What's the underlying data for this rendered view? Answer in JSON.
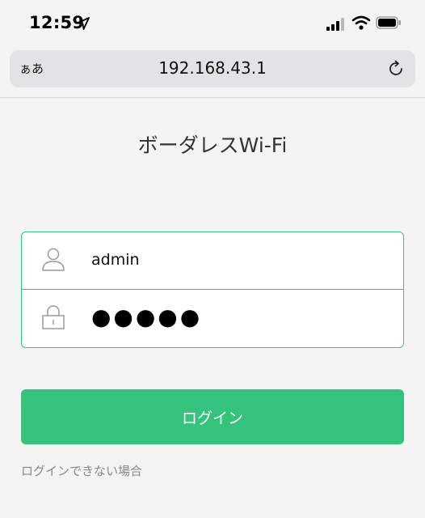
{
  "status_bar": {
    "time": "12:59"
  },
  "browser": {
    "reader_label": "ぁあ",
    "url": "192.168.43.1"
  },
  "page": {
    "title": "ボーダレスWi-Fi"
  },
  "login": {
    "username_value": "admin",
    "password_mask": "●●●●●",
    "submit_label": "ログイン",
    "help_link": "ログインできない場合"
  },
  "colors": {
    "accent": "#35c27d",
    "border": "#36c77f",
    "background": "#f4f4f4"
  },
  "icons": {
    "location": "location-arrow-icon",
    "signal": "cellular-signal-icon",
    "wifi": "wifi-icon",
    "battery": "battery-icon",
    "reload": "reload-icon",
    "user": "user-icon",
    "lock": "lock-icon"
  }
}
